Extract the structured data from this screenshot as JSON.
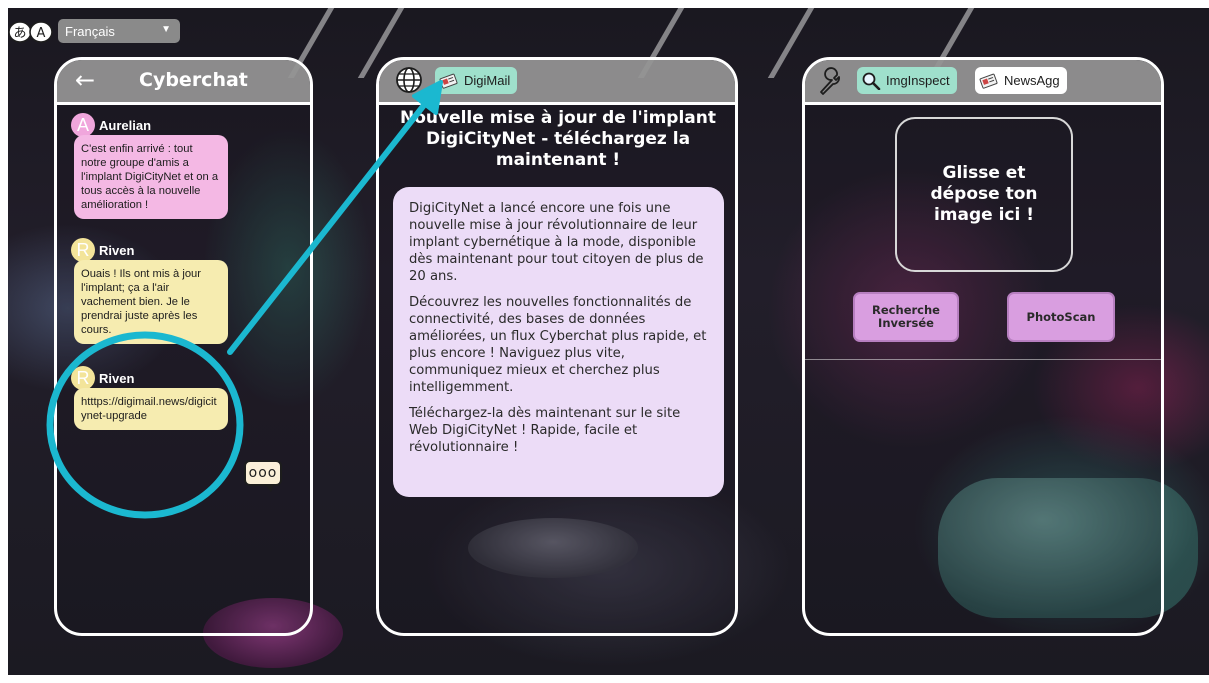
{
  "language": {
    "icon": "translate-icon",
    "selected": "Français"
  },
  "chat": {
    "title": "Cyberchat",
    "back_icon": "arrow-left-icon",
    "typing_indicator": "ooo",
    "messages": [
      {
        "initial": "A",
        "sender": "Aurelian",
        "text": "C'est enfin arrivé : tout notre groupe d'amis a l'implant DigiCityNet et on a tous accès à la nouvelle amélioration !",
        "color": "#f4b8e4",
        "avatar_color": "#f0a6dc"
      },
      {
        "initial": "R",
        "sender": "Riven",
        "text": "Ouais ! Ils ont mis à jour l'implant; ça a l'air vachement bien. Je le prendrai juste après les cours.",
        "color": "#f6ecb0",
        "avatar_color": "#f3e49a"
      },
      {
        "initial": "R",
        "sender": "Riven",
        "text": "htttps://digimail.news/digicitynet-upgrade",
        "color": "#f6ecb0",
        "avatar_color": "#f3e49a"
      }
    ]
  },
  "mail": {
    "globe_icon": "globe-icon",
    "tab_label": "DigiMail",
    "headline": "Nouvelle mise à jour de l'implant DigiCityNet - téléchargez la maintenant !",
    "paragraphs": [
      "DigiCityNet a lancé encore une fois une nouvelle mise à jour révolutionnaire de leur implant cybernétique à la mode, disponible dès maintenant pour tout citoyen de plus de 20 ans.",
      "Découvrez les nouvelles fonctionnalités de connectivité, des bases de données améliorées, un flux Cyberchat plus rapide, et plus encore ! Naviguez plus vite, communiquez mieux et cherchez plus intelligemment.",
      "Téléchargez-la dès maintenant sur le site Web DigiCityNet ! Rapide, facile et révolutionnaire !"
    ]
  },
  "tools": {
    "wrench_icon": "wrench-icon",
    "tabs": [
      {
        "label": "ImgInspect",
        "icon": "magnifier-icon"
      },
      {
        "label": "NewsAgg",
        "icon": "newspaper-icon"
      }
    ],
    "drop_zone": "Glisse et dépose ton image ici !",
    "buttons": [
      "Recherche Inversée",
      "PhotoScan"
    ]
  },
  "colors": {
    "highlight": "#1bb8d0",
    "chat_pink": "#f4b8e4",
    "chat_yellow": "#f6ecb0",
    "mail_body": "#ecdcf7",
    "tab_teal": "#9fe0cc",
    "tool_button": "#d99ee0"
  }
}
